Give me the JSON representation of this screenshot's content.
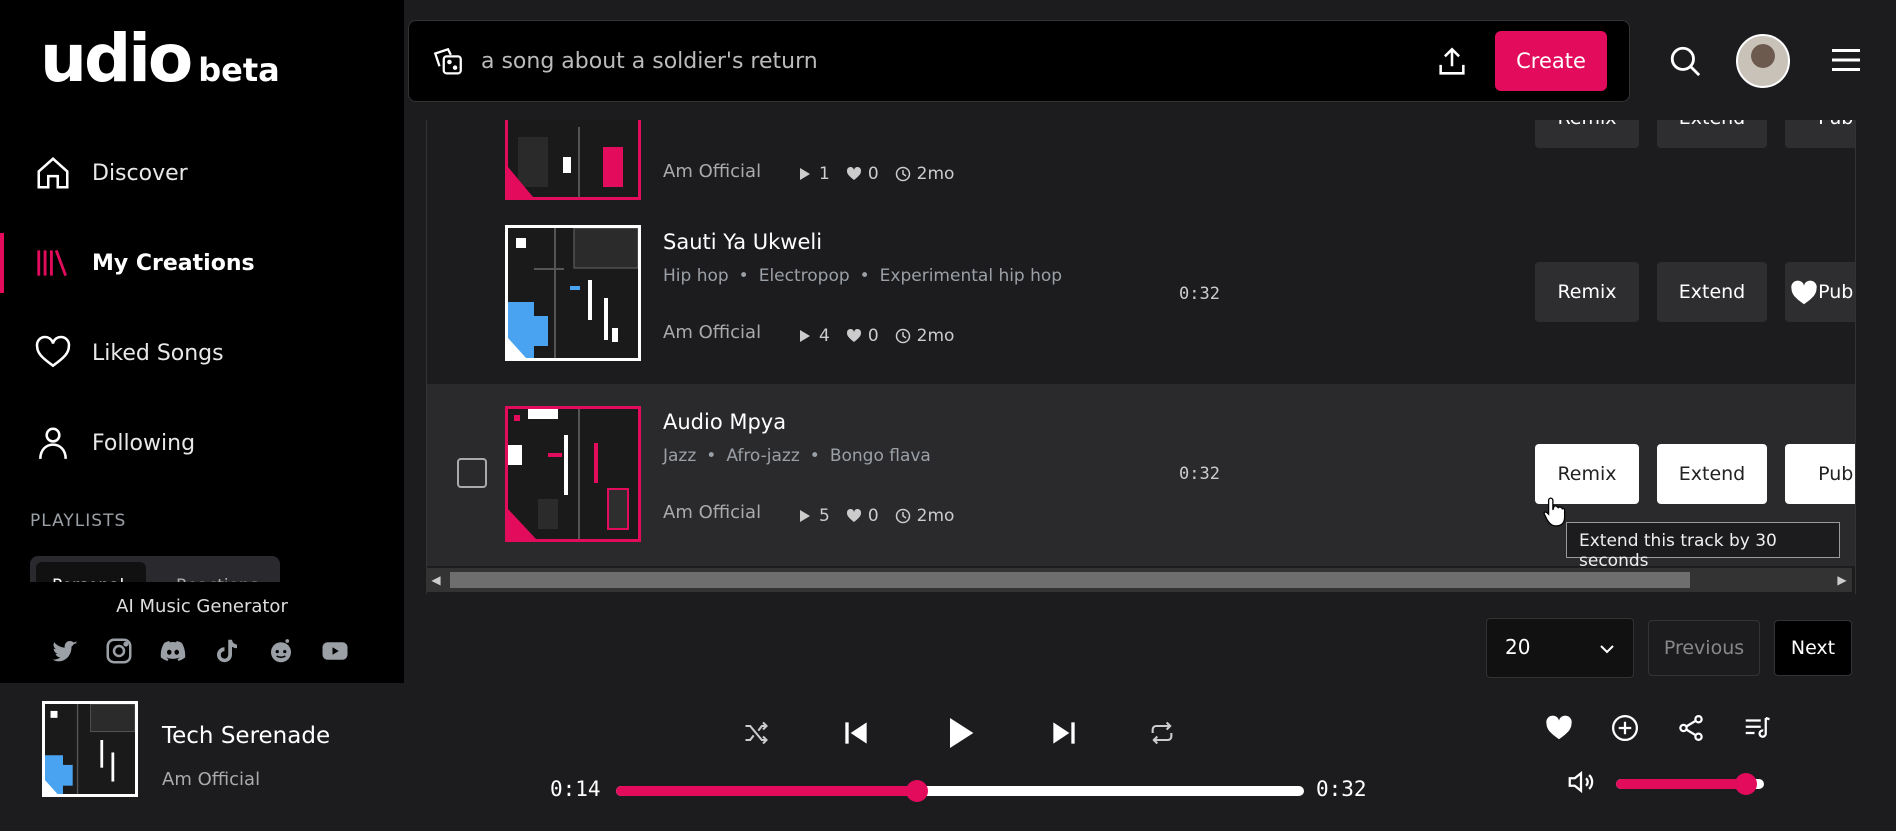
{
  "logo": {
    "main": "udio",
    "beta": "beta"
  },
  "nav": [
    {
      "label": "Discover"
    },
    {
      "label": "My Creations"
    },
    {
      "label": "Liked Songs"
    },
    {
      "label": "Following"
    }
  ],
  "playlists": {
    "title": "PLAYLISTS",
    "tab_active": "Personal",
    "tab_second": "Reactions"
  },
  "sidebar_footer": {
    "tagline": "AI Music Generator"
  },
  "search": {
    "value": "",
    "placeholder": "a song about a soldier's return"
  },
  "header": {
    "create_label": "Create"
  },
  "tracks": [
    {
      "title": "",
      "tags": [],
      "artist": "Am Official",
      "plays": "1",
      "likes": "0",
      "age": "2mo",
      "duration": ""
    },
    {
      "title": "Sauti Ya Ukweli",
      "tags": [
        "Hip hop",
        "Electropop",
        "Experimental hip hop"
      ],
      "artist": "Am Official",
      "plays": "4",
      "likes": "0",
      "age": "2mo",
      "duration": "0:32"
    },
    {
      "title": "Audio Mpya",
      "tags": [
        "Jazz",
        "Afro-jazz",
        "Bongo flava"
      ],
      "artist": "Am Official",
      "plays": "5",
      "likes": "0",
      "age": "2mo",
      "duration": "0:32"
    }
  ],
  "actions": {
    "remix": "Remix",
    "extend": "Extend",
    "publish": "Publish"
  },
  "tooltip": "Extend this track by 30 seconds",
  "pagination": {
    "per_page": "20",
    "previous": "Previous",
    "next": "Next"
  },
  "player": {
    "title": "Tech Serenade",
    "artist": "Am Official",
    "elapsed": "0:14",
    "total": "0:32",
    "progress": 0.4375,
    "volume": 0.88
  },
  "colors": {
    "accent": "#e30b5c",
    "blue": "#4aa3f0"
  }
}
